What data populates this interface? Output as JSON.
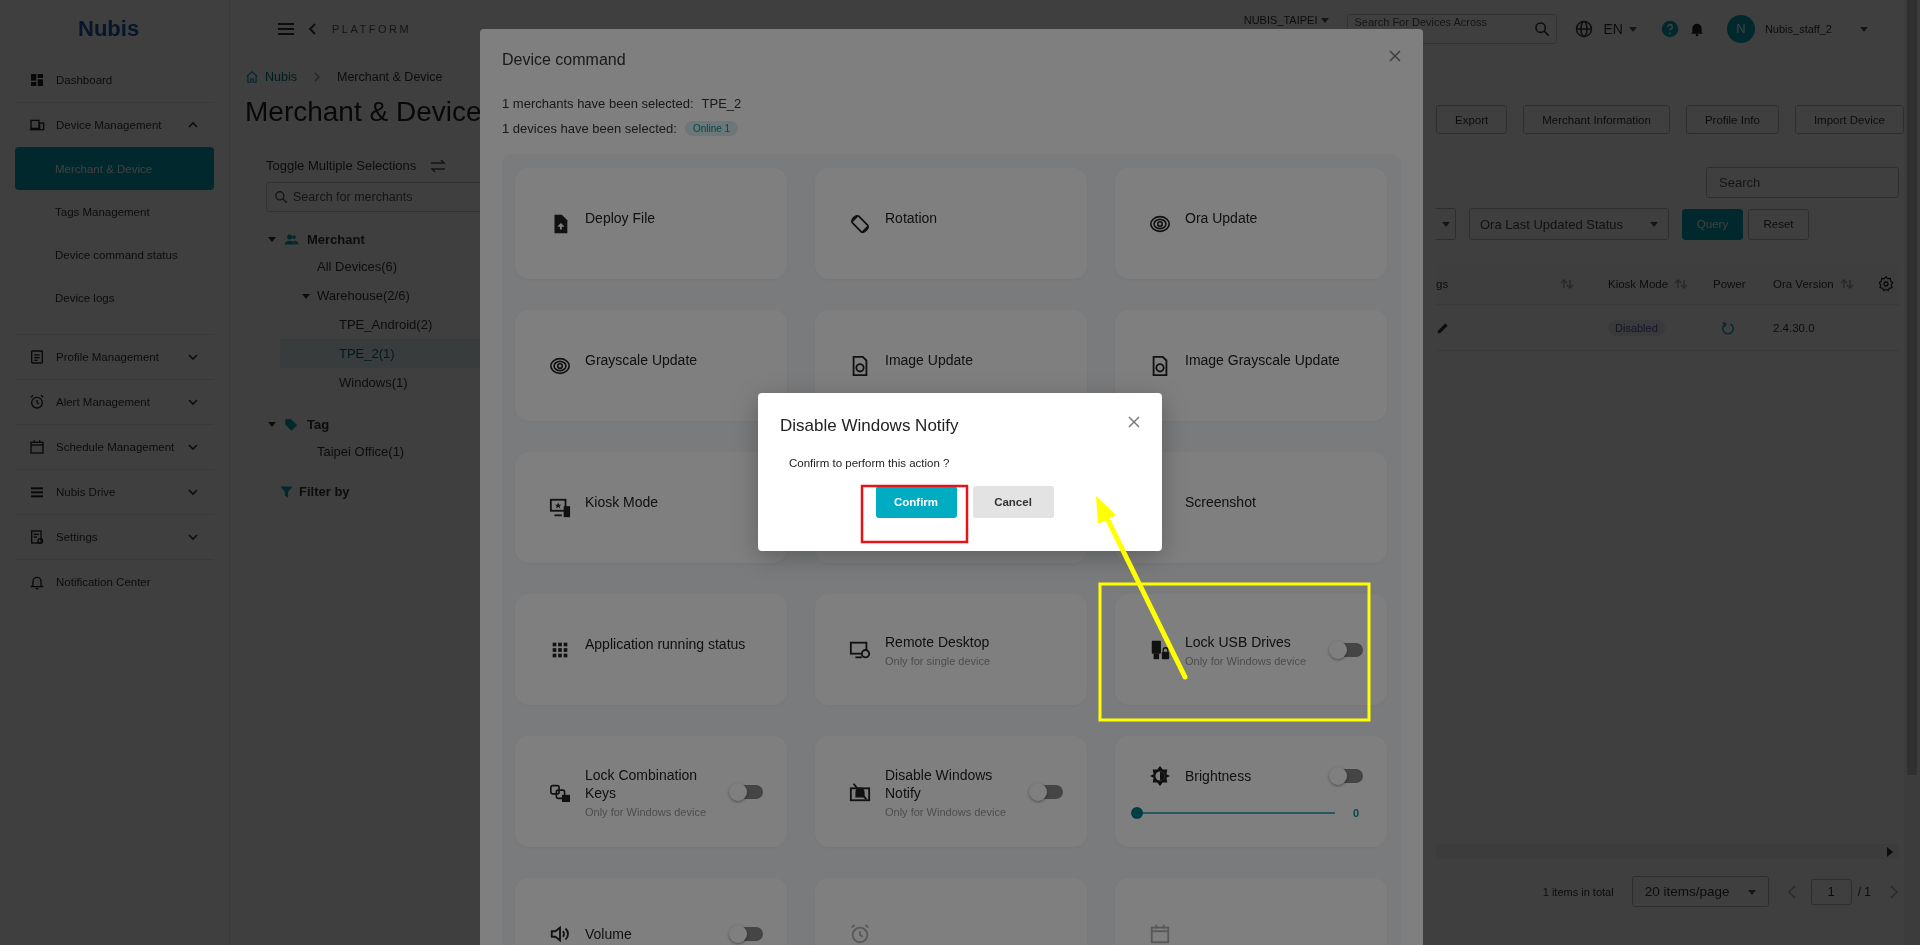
{
  "sidebar": {
    "logo": "Nubis",
    "items": [
      {
        "label": "Dashboard"
      },
      {
        "label": "Device Management",
        "expanded": true,
        "children": [
          {
            "label": "Merchant & Device",
            "selected": true
          },
          {
            "label": "Tags Management",
            "selected": false
          },
          {
            "label": "Device command status",
            "selected": false
          },
          {
            "label": "Device logs",
            "selected": false
          }
        ]
      },
      {
        "label": "Profile Management",
        "expanded": false
      },
      {
        "label": "Alert Management",
        "expanded": false
      },
      {
        "label": "Schedule Management",
        "expanded": false
      },
      {
        "label": "Nubis Drive",
        "expanded": false
      },
      {
        "label": "Settings",
        "expanded": false
      },
      {
        "label": "Notification Center"
      }
    ]
  },
  "header": {
    "back_label": "PLATFORM",
    "org": "NUBIS_TAIPEI",
    "search": {
      "placeholder": "Search For Devices Across"
    },
    "language": "EN",
    "avatar": "N",
    "user": "Nubis_staff_2"
  },
  "breadcrumb": {
    "home": "Nubis",
    "current": "Merchant & Device"
  },
  "title": "Merchant & Device",
  "tree": {
    "toggle_label": "Toggle Multiple Selections",
    "search": {
      "placeholder": "Search for merchants"
    },
    "groups": [
      {
        "label": "Merchant",
        "expanded": true,
        "children": [
          {
            "label": "All Devices(6)",
            "selected": false
          },
          {
            "label": "Warehouse(2/6)",
            "selected": false,
            "expanded": true,
            "children": [
              {
                "label": "TPE_Android(2)",
                "selected": false
              },
              {
                "label": "TPE_2(1)",
                "selected": true
              },
              {
                "label": "Windows(1)",
                "selected": false
              }
            ]
          }
        ]
      },
      {
        "label": "Tag",
        "expanded": true,
        "children": [
          {
            "label": "Taipei Office(1)",
            "selected": false
          }
        ]
      }
    ],
    "filter_label": "Filter by"
  },
  "actions": [
    "Export",
    "Merchant Information",
    "Profile Info",
    "Import Device"
  ],
  "table_search": {
    "placeholder": "Search"
  },
  "filters": {
    "dropdowns": [
      {
        "kind": "cut"
      },
      {
        "kind": "select",
        "placeholder": "Ora Last Updated Status"
      }
    ],
    "buttons": [
      {
        "label": "Query",
        "kind": "primary"
      },
      {
        "label": "Reset",
        "kind": "default"
      }
    ]
  },
  "table": {
    "columns": [
      {
        "label": "gs",
        "sortable": true
      },
      {
        "label": "Kiosk Mode",
        "sortable": true
      },
      {
        "label": "Power",
        "sortable": false
      },
      {
        "label": "Ora Version",
        "sortable": true
      }
    ],
    "rows": [
      {
        "cells": [
          {
            "kind": "edit"
          },
          {
            "kind": "badge",
            "text": "Disabled"
          },
          {
            "kind": "power"
          },
          {
            "kind": "text",
            "text": "2.4.30.0"
          }
        ]
      }
    ]
  },
  "pagination": {
    "total": "1 items in total",
    "page_size": "20 items/page",
    "page": "1",
    "pages": "/ 1"
  },
  "modal": {
    "title": "Device command",
    "merchants_label": "1 merchants have been selected:",
    "merchants_value": "TPE_2",
    "devices_label": "1 devices have been selected:",
    "devices_badge": "Online 1",
    "commands": [
      {
        "kind": "plain",
        "label": "Deploy File"
      },
      {
        "kind": "plain",
        "label": "Rotation"
      },
      {
        "kind": "plain",
        "label": "Ora Update"
      },
      {
        "kind": "plain",
        "label": "Grayscale Update"
      },
      {
        "kind": "plain",
        "label": "Image Update"
      },
      {
        "kind": "plain",
        "label": "Image Grayscale Update"
      },
      {
        "kind": "plain",
        "label": "Kiosk Mode"
      },
      {
        "kind": "covered"
      },
      {
        "kind": "plain",
        "label": "Screenshot"
      },
      {
        "kind": "plain",
        "label": "Application running status"
      },
      {
        "kind": "plain",
        "label": "Remote Desktop",
        "note": "Only for single device"
      },
      {
        "kind": "toggle",
        "label": "Lock USB Drives",
        "note": "Only for Windows device",
        "on": false
      },
      {
        "kind": "toggle",
        "label": "Lock Combination Keys",
        "note": "Only for Windows device",
        "on": false
      },
      {
        "kind": "toggle",
        "label": "Disable Windows Notify",
        "note": "Only for Windows device",
        "on": false
      },
      {
        "kind": "slider",
        "label": "Brightness",
        "on": false,
        "level": 0,
        "reading": "0"
      },
      {
        "kind": "toggle",
        "label": "Volume",
        "on": false
      },
      {
        "kind": "cut"
      },
      {
        "kind": "cut"
      }
    ]
  },
  "confirm": {
    "title": "Disable Windows Notify",
    "message": "Confirm to perform this action ?",
    "buttons": [
      {
        "label": "Confirm",
        "kind": "primary"
      },
      {
        "label": "Cancel",
        "kind": "default"
      }
    ]
  },
  "annotations": [
    {
      "kind": "frame",
      "color": "#e8121a"
    },
    {
      "kind": "frame",
      "color": "#ffff00"
    },
    {
      "kind": "arrow",
      "color": "#ffff00"
    }
  ]
}
